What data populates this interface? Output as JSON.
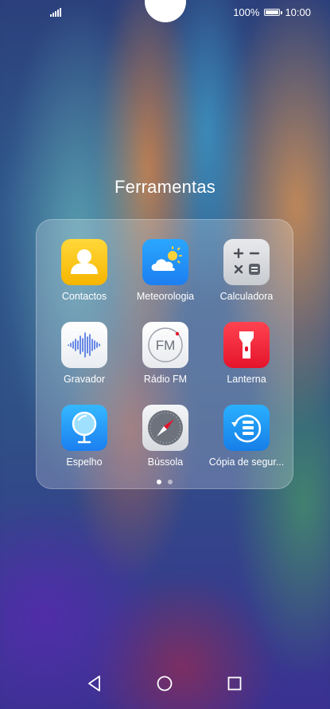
{
  "status_bar": {
    "battery": "100%",
    "time": "10:00",
    "battery_level": 1.0
  },
  "folder": {
    "title": "Ferramentas",
    "apps": [
      {
        "label": "Contactos",
        "icon": "contacts-icon"
      },
      {
        "label": "Meteorologia",
        "icon": "weather-icon"
      },
      {
        "label": "Calculadora",
        "icon": "calculator-icon"
      },
      {
        "label": "Gravador",
        "icon": "recorder-icon"
      },
      {
        "label": "Rádio FM",
        "icon": "radio-fm-icon",
        "icon_text": "FM"
      },
      {
        "label": "Lanterna",
        "icon": "flashlight-icon"
      },
      {
        "label": "Espelho",
        "icon": "mirror-icon"
      },
      {
        "label": "Bússola",
        "icon": "compass-icon"
      },
      {
        "label": "Cópia de segur...",
        "icon": "backup-icon"
      }
    ],
    "pages": 2,
    "current_page": 1
  },
  "nav_bar": {
    "back": "back-icon",
    "home": "home-icon",
    "recents": "recents-icon"
  },
  "colors": {
    "contacts": "#F7B500",
    "weather": "#1D7EF0",
    "flashlight": "#E5142C",
    "accent_white": "#FFFFFF"
  }
}
